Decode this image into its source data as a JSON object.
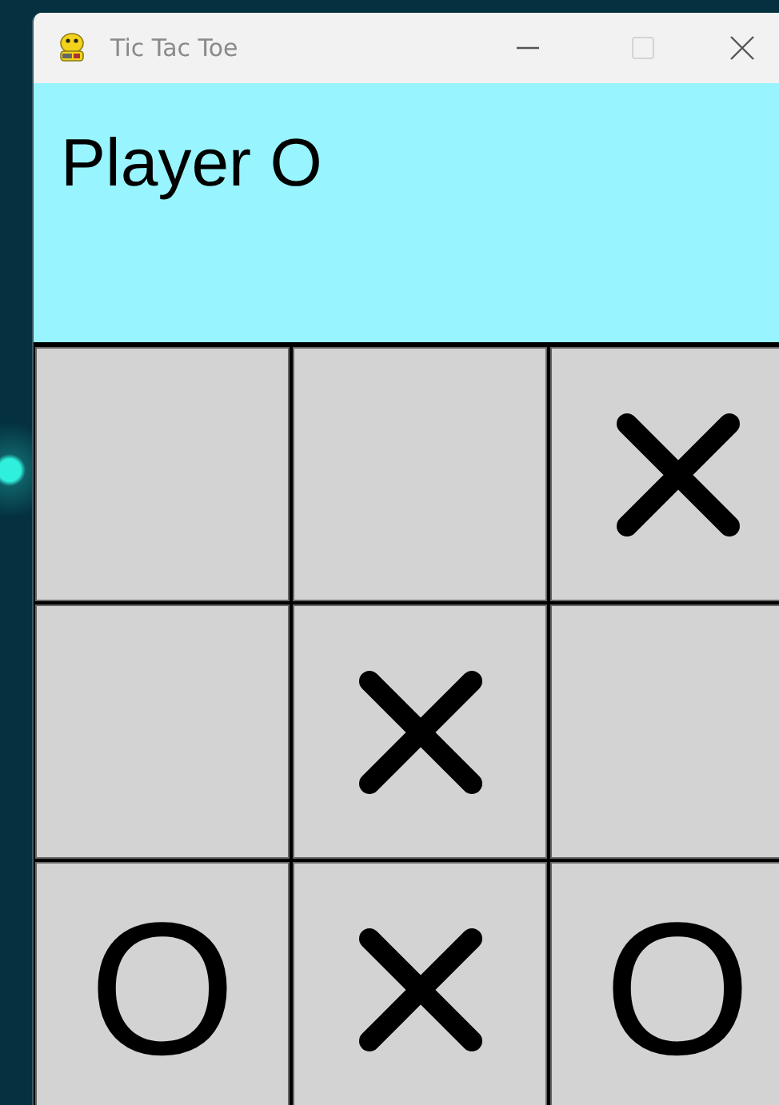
{
  "window": {
    "title": "Tic Tac Toe",
    "maximize_disabled": true
  },
  "status": "Player O",
  "board": [
    {
      "kind": "empty"
    },
    {
      "kind": "empty"
    },
    {
      "kind": "x"
    },
    {
      "kind": "empty"
    },
    {
      "kind": "x"
    },
    {
      "kind": "empty"
    },
    {
      "kind": "o",
      "text": "O"
    },
    {
      "kind": "x"
    },
    {
      "kind": "o",
      "text": "O"
    }
  ]
}
